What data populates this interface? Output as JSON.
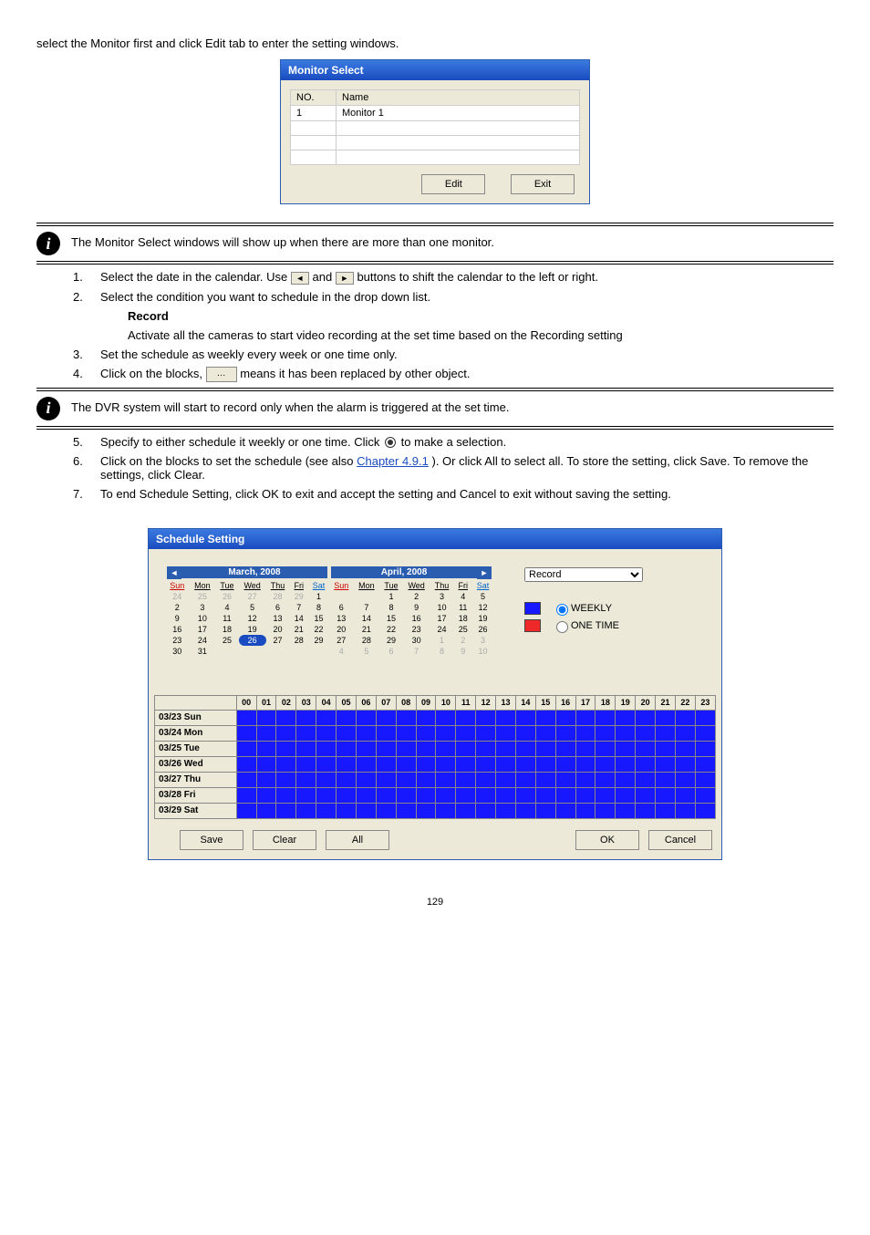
{
  "page_number": "129",
  "intro": "select the Monitor first and click Edit tab to enter the setting windows.",
  "monitor_select": {
    "title": "Monitor Select",
    "col_no": "NO.",
    "col_name": "Name",
    "row_no": "1",
    "row_name": "Monitor 1",
    "edit": "Edit",
    "exit": "Exit"
  },
  "info1": "The Monitor Select windows will show up when there are more than one monitor.",
  "step1": {
    "num": "1.",
    "text_a": "Select the date in the calendar. Use",
    "text_b": "and",
    "text_c": "buttons to shift the calendar to the left or right."
  },
  "step2": {
    "num": "2.",
    "text": "Select the condition you want to schedule in the drop down list."
  },
  "record_label": "Record",
  "record_desc": "Activate all the cameras to start video recording at the set time based on the Recording setting",
  "step3": {
    "num": "3.",
    "text": "Set the schedule as weekly every week or one time only."
  },
  "step4": {
    "num": "4.",
    "text_a": "Click on the blocks, ",
    "text_b": " means it has been replaced by other object."
  },
  "info2": "The DVR system will start to record only when the alarm is triggered at the set time.",
  "step5": {
    "num": "5.",
    "text_a": "Specify to either schedule it weekly or one time. Click",
    "text_b": "to make a selection."
  },
  "step6": {
    "num": "6.",
    "text_a": "Click on the blocks to set the schedule (see also ",
    "link": "Chapter 4.9.1",
    "text_b": "). Or click All to select all. To store the setting, click Save. To remove the settings, click Clear."
  },
  "step7": {
    "num": "7.",
    "text": "To end Schedule Setting, click OK to exit and accept the setting and Cancel to exit without saving the setting."
  },
  "schedule": {
    "title": "Schedule Setting",
    "mar": "March, 2008",
    "apr": "April, 2008",
    "dow": [
      "Sun",
      "Mon",
      "Tue",
      "Wed",
      "Thu",
      "Fri",
      "Sat"
    ],
    "dropdown": "Record",
    "weekly": "WEEKLY",
    "onetime": "ONE TIME",
    "hours": [
      "00",
      "01",
      "02",
      "03",
      "04",
      "05",
      "06",
      "07",
      "08",
      "09",
      "10",
      "11",
      "12",
      "13",
      "14",
      "15",
      "16",
      "17",
      "18",
      "19",
      "20",
      "21",
      "22",
      "23"
    ],
    "rows": [
      "03/23 Sun",
      "03/24 Mon",
      "03/25 Tue",
      "03/26 Wed",
      "03/27 Thu",
      "03/28 Fri",
      "03/29 Sat"
    ],
    "save": "Save",
    "clear": "Clear",
    "all": "All",
    "ok": "OK",
    "cancel": "Cancel"
  }
}
